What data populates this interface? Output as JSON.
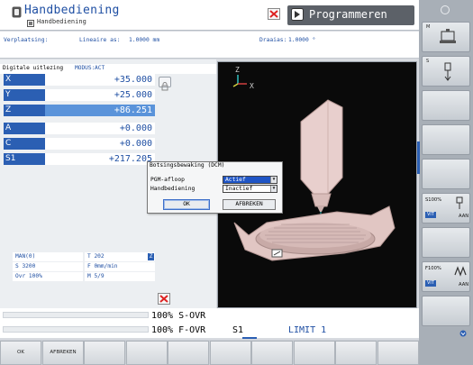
{
  "header": {
    "title": "Handbediening",
    "subtitle": "Handbediening",
    "second_mode": "Programmeren"
  },
  "inforow": {
    "verplaatsing_label": "Verplaatsing:",
    "linear_label": "Lineaire as:",
    "linear_value": "1.0000 mm",
    "draaias_label": "Draaias:",
    "draaias_value": "1.0000 °"
  },
  "position_panel": {
    "title": "Digitale uitlezing",
    "mode_label": "MODUS:",
    "mode_value": "ACT",
    "axes": [
      {
        "name": "X",
        "value": "+35.000",
        "selected": false
      },
      {
        "name": "Y",
        "value": "+25.000",
        "selected": false
      },
      {
        "name": "Z",
        "value": "+86.251",
        "selected": true
      },
      {
        "name": "A",
        "value": "+0.000",
        "selected": false
      },
      {
        "name": "C",
        "value": "+0.000",
        "selected": false
      },
      {
        "name": "S1",
        "value": "+217.205",
        "selected": false
      }
    ]
  },
  "status": {
    "man": "MAN(0)",
    "tool": "T 202",
    "tool_axis": "Z",
    "spindle": "S 3200",
    "feed": "F 0mm/min",
    "ovr": "Ovr 100%",
    "mfunc": "M 5/9"
  },
  "dialog": {
    "title": "Botsingsbewaking (DCM)",
    "rows": [
      {
        "label": "PGM-afloop",
        "value": "Actief",
        "active": true
      },
      {
        "label": "Handbediening",
        "value": "Inactief",
        "active": false
      }
    ],
    "ok_label": "OK",
    "cancel_label": "AFBREKEN"
  },
  "view3d": {
    "axis_z": "Z",
    "axis_x": "X"
  },
  "bottom_status": {
    "s_ovr": "100% S-OVR",
    "f_ovr": "100% F-OVR",
    "spindle_label": "S1",
    "limit_label": "LIMIT 1"
  },
  "softkeys": {
    "labels": [
      "OK",
      "AFBREKEN",
      "",
      "",
      "",
      "",
      "",
      "",
      "",
      ""
    ]
  },
  "right_softkeys": {
    "m_letter": "M",
    "s_letter": "S",
    "s_override": "S100%",
    "s_vit": "VIT",
    "s_aan": "AAN",
    "f_override": "F100%",
    "f_vit": "VIT",
    "f_aan": "AAN"
  },
  "colors": {
    "accent": "#2b5fb3",
    "selected_axis": "#5a93da",
    "text_blue": "#1f4fa3"
  }
}
